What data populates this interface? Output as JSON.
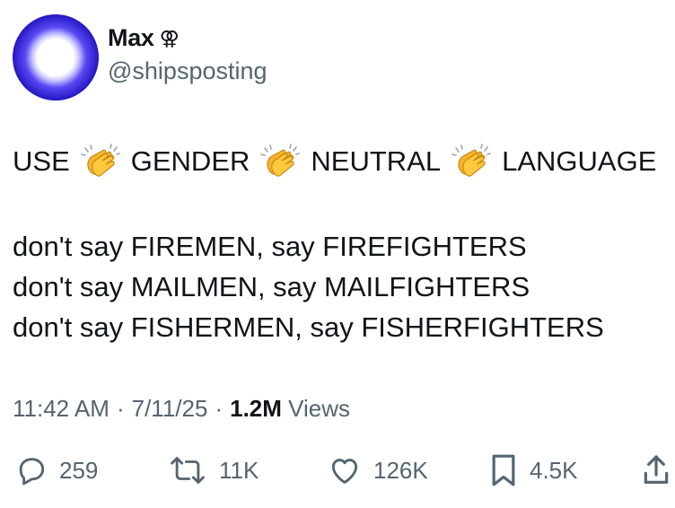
{
  "author": {
    "display_name": "Max",
    "name_symbol": "⚢",
    "handle": "@shipsposting",
    "avatar_icon": "avatar-glowing-orb"
  },
  "tweet": {
    "headline_words": [
      "USE",
      "GENDER",
      "NEUTRAL",
      "LANGUAGE"
    ],
    "separator_icon": "clapping-hands-emoji",
    "lines": [
      "don't say FIREMEN, say FIREFIGHTERS",
      "don't say MAILMEN, say MAILFIGHTERS",
      "don't say FISHERMEN, say FISHERFIGHTERS"
    ]
  },
  "meta": {
    "time": "11:42 AM",
    "dot1": "·",
    "date": "7/11/25",
    "dot2": "·",
    "views_count": "1.2M",
    "views_label": "Views"
  },
  "actions": {
    "replies": "259",
    "reposts": "11K",
    "likes": "126K",
    "bookmarks": "4.5K"
  },
  "colors": {
    "text": "#0f1419",
    "secondary": "#536471",
    "avatar_core": "#ffffff",
    "avatar_ring": "#2a1dc9",
    "clap": "#f7b32b"
  }
}
